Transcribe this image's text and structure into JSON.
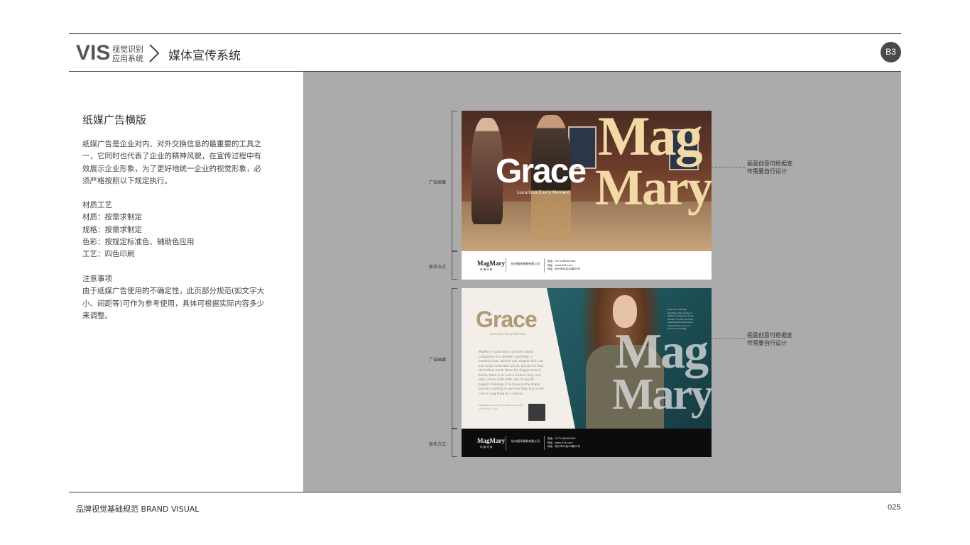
{
  "header": {
    "brand": "VIS",
    "brand_sub_line1": "视觉识别",
    "brand_sub_line2": "应用系统",
    "section_title": "媒体宣传系统",
    "page_badge": "B3"
  },
  "left": {
    "title": "纸媒广告横版",
    "intro_lines": [
      "纸媒广告是企业对内、对外交换信息的最重要的工具之",
      "一，它同时也代表了企业的精神风貌，在宣传过程中有",
      "效展示企业形象，为了更好地统一企业的视觉形象，必",
      "须严格按照以下规定执行。"
    ],
    "material_lines": [
      "材质工艺",
      "材质：按需求制定",
      "规格：按需求制定",
      "色彩：按规定标准色、辅助色应用",
      "工艺：四色印刷"
    ],
    "notice_lines": [
      "注意事项",
      "由于纸媒广告使用的不确定性，此页部分规范(如文字大",
      "小、间距等)可作为参考使用，具体可根据实际内容多少",
      "来调整。"
    ]
  },
  "annotations": {
    "ad_area_label": "广告画面",
    "contact_label": "联系方式",
    "note_line1": "画面创意可根据宣",
    "note_line2": "传需要自行设计"
  },
  "ad1": {
    "grace": "Grace",
    "tagline": "Luxurious Every Moment",
    "mag": "Mag",
    "mary": "Mary",
    "logo": "MagMary",
    "logo_sub": "玛 格 玛 丽",
    "company": "杭州墨泽服装有限公司",
    "contact_1": "电话：0571-86XXXXXX",
    "contact_2": "网址：www.XXX.com",
    "contact_3": "地址：杭州市XX区XX路XX号"
  },
  "ad2": {
    "grace": "Grace",
    "tagline": "Luxurious Every Moment",
    "body": "MagMary's goal was to provide a basic component of a woman's wardrobe, a beautiful coat, tailored suit, elegant skirt, not only to be reasonable priced, but also to lead the fashion trend. When the Reggio town of Emilia, there is no such a fashion shop, only with a horse cloth cloth, was facing the biggest challenge is to convince the draper business clothing in post-war Italy, buy a new coat is a big thing for a woman.",
    "small_text": "MagMary is a symbol of elegance, quality and timeless style.",
    "right_text": "Over the next few decades, thousands of fashion companies have worked in that direction, claiming that they have grasped the pulse of women's clothing.",
    "mag": "Mag",
    "mary": "Mary",
    "logo": "MagMary",
    "logo_sub": "玛 格 玛 丽",
    "company": "杭州墨泽服装有限公司",
    "contact_1": "电话：0571-86XXXXXX",
    "contact_2": "网址：www.XXX.com",
    "contact_3": "地址：杭州市XX区XX路XX号"
  },
  "footer": {
    "left_text": "品牌视觉基础规范   BRAND VISUAL",
    "page_number": "025"
  },
  "colors": {
    "panel_gray": "#ababab",
    "mag_mary_gold": "#f2d9a6",
    "grace_tan": "#b09a78",
    "badge": "#4a4a4a"
  }
}
